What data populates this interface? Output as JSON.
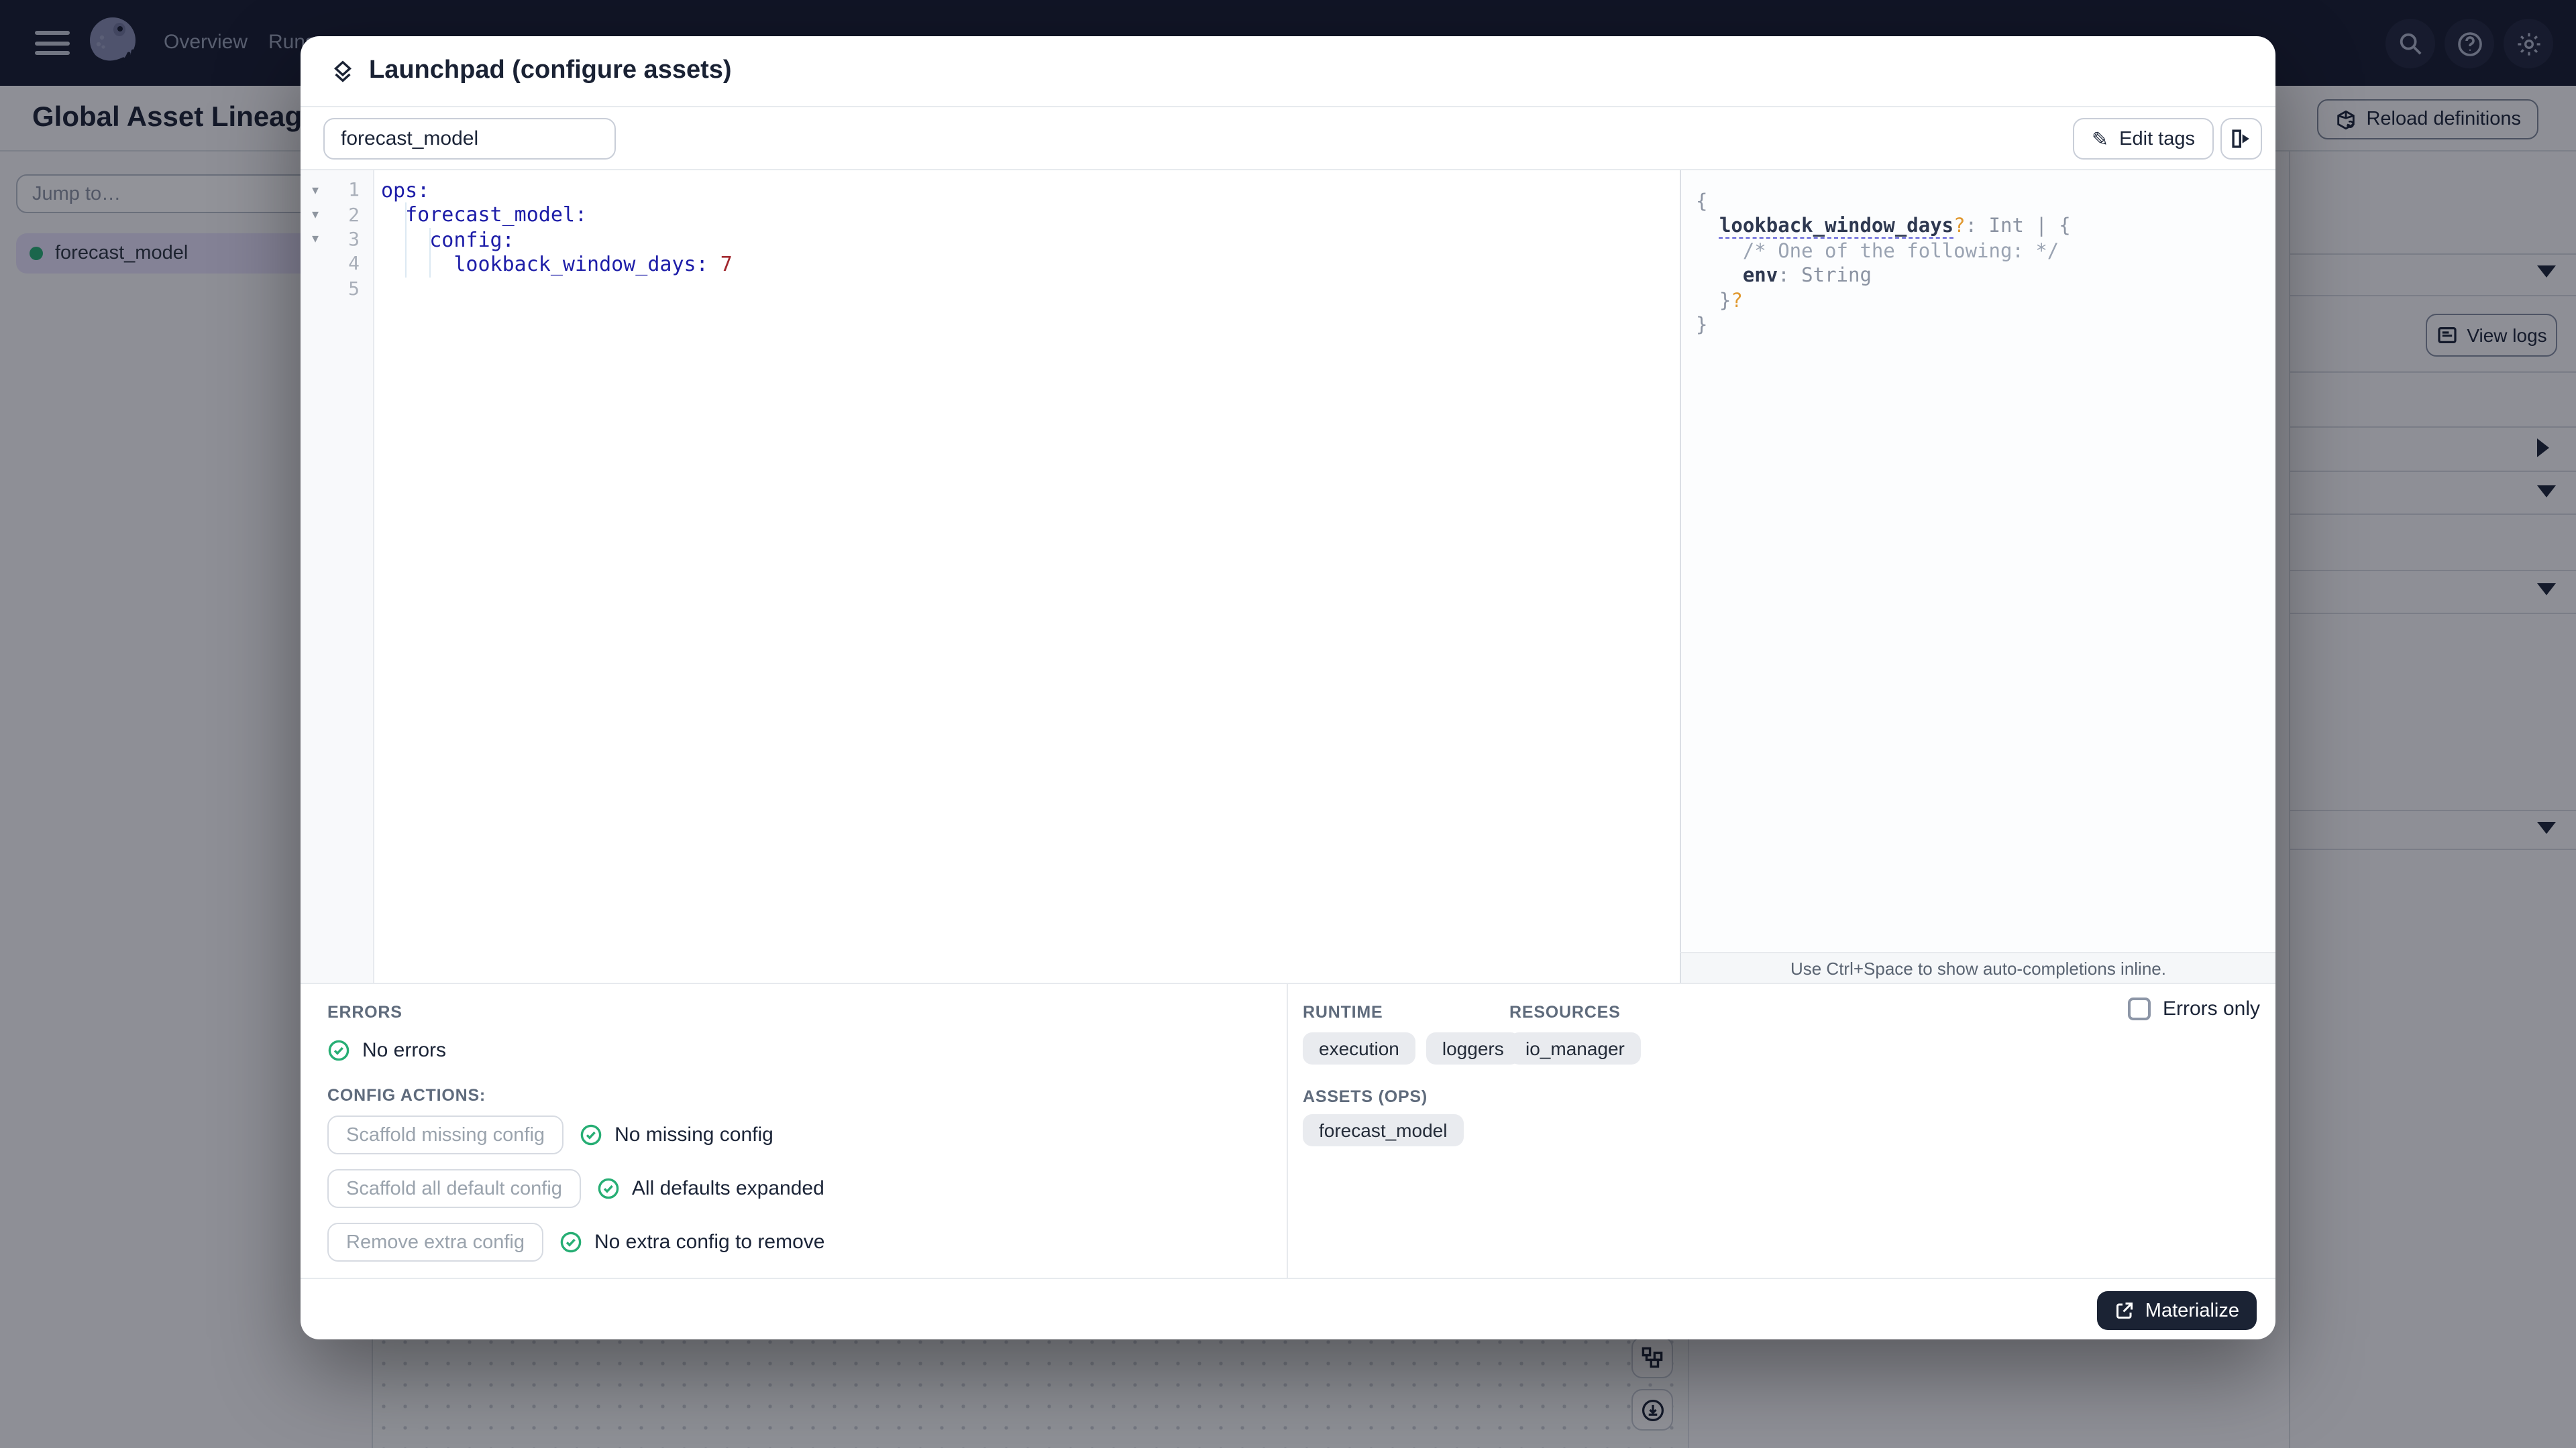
{
  "nav": {
    "items": [
      {
        "label": "Overview"
      },
      {
        "label": "Runs"
      }
    ],
    "icons": [
      "menu-icon",
      "dagster-logo",
      "search-icon",
      "help-icon",
      "gear-icon"
    ]
  },
  "page": {
    "title": "Global Asset Lineage",
    "reload_button": "Reload definitions",
    "jump_placeholder": "Jump to…",
    "asset_item": "forecast_model",
    "view_logs": "View logs"
  },
  "modal": {
    "title": "Launchpad (configure assets)",
    "name_input_value": "forecast_model",
    "edit_tags_label": "Edit tags",
    "hint": "Use Ctrl+Space to show auto-completions inline.",
    "editor": {
      "lines": [
        {
          "n": "1",
          "fold": true,
          "tokens": [
            {
              "t": "ops:",
              "c": "k"
            }
          ]
        },
        {
          "n": "2",
          "fold": true,
          "tokens": [
            {
              "t": "  "
            },
            {
              "t": "forecast_model:",
              "c": "k"
            }
          ]
        },
        {
          "n": "3",
          "fold": true,
          "tokens": [
            {
              "t": "    "
            },
            {
              "t": "config:",
              "c": "k"
            }
          ]
        },
        {
          "n": "4",
          "fold": false,
          "tokens": [
            {
              "t": "      "
            },
            {
              "t": "lookback_window_days:",
              "c": "k"
            },
            {
              "t": " "
            },
            {
              "t": "7",
              "c": "num"
            }
          ]
        },
        {
          "n": "5",
          "fold": false,
          "tokens": []
        }
      ]
    },
    "schema": {
      "lines": [
        [
          {
            "t": "{"
          }
        ],
        [
          {
            "t": "  "
          },
          {
            "t": "lookback_window_days",
            "c": "key dashed"
          },
          {
            "t": "?",
            "c": "q"
          },
          {
            "t": ": Int | {"
          }
        ],
        [
          {
            "t": "    "
          },
          {
            "t": "/* One of the following: */",
            "c": "cm"
          }
        ],
        [
          {
            "t": "    "
          },
          {
            "t": "env",
            "c": "key"
          },
          {
            "t": ": String"
          }
        ],
        [
          {
            "t": "  }"
          },
          {
            "t": "?",
            "c": "q"
          }
        ],
        [
          {
            "t": "}"
          }
        ]
      ]
    },
    "errors": {
      "label": "ERRORS",
      "status": "No errors"
    },
    "config_actions": {
      "label": "CONFIG ACTIONS:",
      "rows": [
        {
          "button": "Scaffold missing config",
          "status": "No missing config"
        },
        {
          "button": "Scaffold all default config",
          "status": "All defaults expanded"
        },
        {
          "button": "Remove extra config",
          "status": "No extra config to remove"
        }
      ]
    },
    "runtime": {
      "label": "RUNTIME",
      "tags": [
        "execution",
        "loggers"
      ]
    },
    "resources": {
      "label": "RESOURCES",
      "tags": [
        "io_manager"
      ]
    },
    "assets_ops": {
      "label": "ASSETS (OPS)",
      "tags": [
        "forecast_model"
      ]
    },
    "errors_only_label": "Errors only",
    "materialize_label": "Materialize"
  },
  "colors": {
    "accent_green": "#27ae74",
    "nav_bg": "#151b2e",
    "selection_lavender": "#e6e1fa",
    "code_key": "#1d1da8",
    "code_number": "#a1262d",
    "schema_optional_marker": "#e0982f",
    "materialize_bg": "#1b2334"
  }
}
